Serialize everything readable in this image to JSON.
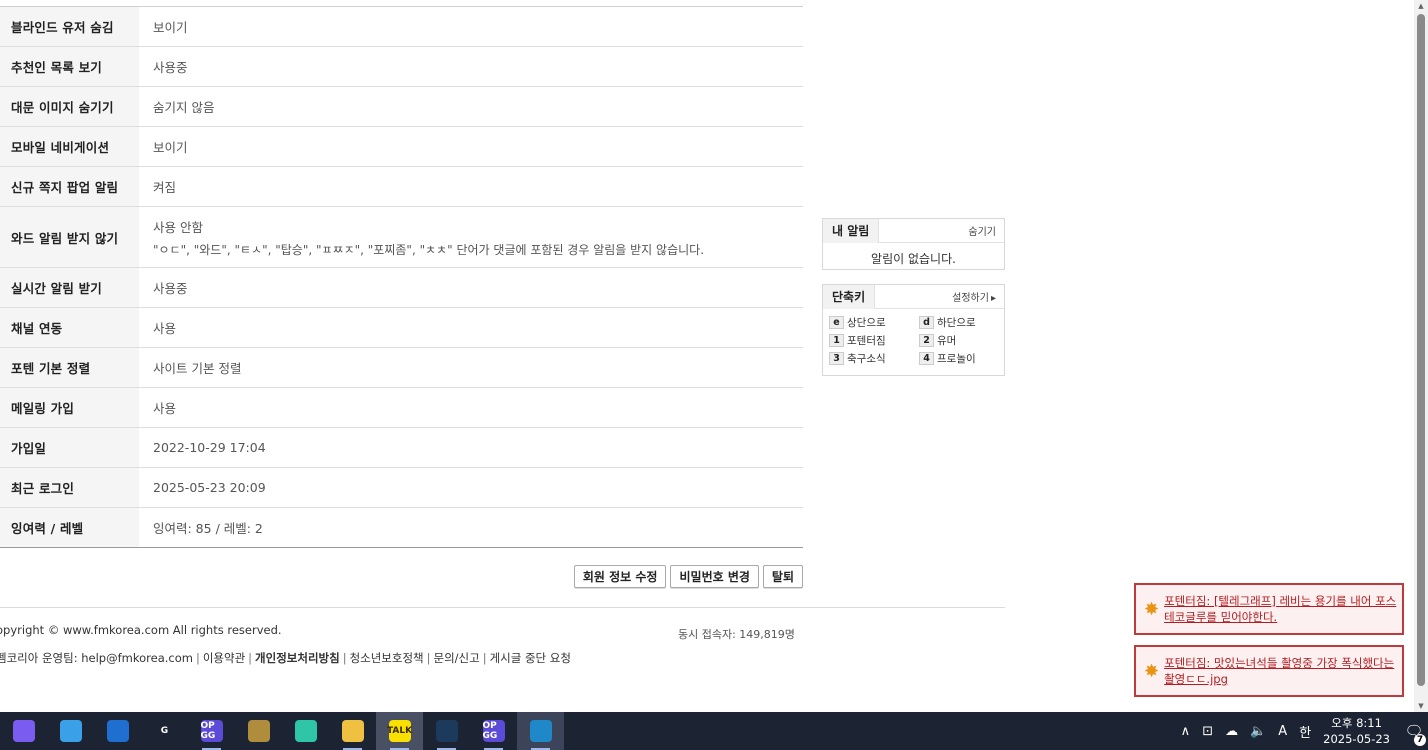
{
  "settings": [
    {
      "label": "블라인드 유저 숨김",
      "value": "보이기"
    },
    {
      "label": "추천인 목록 보기",
      "value": "사용중"
    },
    {
      "label": "대문 이미지 숨기기",
      "value": "숨기지 않음"
    },
    {
      "label": "모바일 네비게이션",
      "value": "보이기"
    },
    {
      "label": "신규 쪽지 팝업 알림",
      "value": "켜짐"
    },
    {
      "label": "와드 알림 받지 않기",
      "value": "사용 안함",
      "sub": "\"ㅇㄷ\", \"와드\", \"ㅌㅅ\", \"탑승\", \"ㅍㅉㅈ\", \"포찌좀\", \"ㅊㅊ\" 단어가 댓글에 포함된 경우 알림을 받지 않습니다."
    },
    {
      "label": "실시간 알림 받기",
      "value": "사용중"
    },
    {
      "label": "채널 연동",
      "value": "사용"
    },
    {
      "label": "포텐 기본 정렬",
      "value": "사이트 기본 정렬"
    },
    {
      "label": "메일링 가입",
      "value": "사용"
    },
    {
      "label": "가입일",
      "value": "2022-10-29 17:04"
    },
    {
      "label": "최근 로그인",
      "value": "2025-05-23 20:09"
    },
    {
      "label": "잉여력 / 레벨",
      "value": "잉여력: 85 / 레벨: 2"
    }
  ],
  "actions": {
    "edit_info": "회원 정보 수정",
    "change_password": "비밀번호 변경",
    "withdraw": "탈퇴"
  },
  "footer": {
    "copyright": "opyright © www.fmkorea.com All rights reserved.",
    "concurrent": "동시 접속자: 149,819명",
    "contact": "펨코리아 운영팀: help@fmkorea.com",
    "terms": "이용약관",
    "privacy": "개인정보처리방침",
    "youth": "청소년보호정책",
    "report": "문의/신고",
    "takedown": "게시글 중단 요청"
  },
  "alerts_widget": {
    "title": "내 알림",
    "hide": "숨기기",
    "empty": "알림이 없습니다."
  },
  "shortcuts_widget": {
    "title": "단축키",
    "settings": "설정하기",
    "items": [
      {
        "key": "e",
        "label": "상단으로"
      },
      {
        "key": "d",
        "label": "하단으로"
      },
      {
        "key": "1",
        "label": "포텐터짐"
      },
      {
        "key": "2",
        "label": "유머"
      },
      {
        "key": "3",
        "label": "축구소식"
      },
      {
        "key": "4",
        "label": "프로놀이"
      }
    ]
  },
  "toasts": [
    {
      "text": "포텐터짐: [텔레그래프] 레비는 용기를 내어 포스테코글루를 믿어야한다."
    },
    {
      "text": "포텐터짐: 맛있는녀석들 촬영중 가장 폭식했다는 촬영ㄷㄷ.jpg"
    }
  ],
  "taskbar": {
    "apps": [
      {
        "name": "copilot",
        "color": "#7b5cf0",
        "label": ""
      },
      {
        "name": "paint",
        "color": "#3aa0e8",
        "label": ""
      },
      {
        "name": "store",
        "color": "#1f6fd1",
        "label": ""
      },
      {
        "name": "g-app",
        "color": "#1c2433",
        "label": "G"
      },
      {
        "name": "opgg",
        "color": "#5b4bd6",
        "label": "OP GG"
      },
      {
        "name": "league",
        "color": "#b08d3c",
        "label": ""
      },
      {
        "name": "bird-app",
        "color": "#2fc6a8",
        "label": ""
      },
      {
        "name": "explorer",
        "color": "#f0c040",
        "label": ""
      },
      {
        "name": "kakaotalk",
        "color": "#f9e000",
        "label": "TALK"
      },
      {
        "name": "steam",
        "color": "#1b3a5c",
        "label": ""
      },
      {
        "name": "opgg-2",
        "color": "#5b4bd6",
        "label": "OP GG"
      },
      {
        "name": "edge",
        "color": "#1e88c9",
        "label": ""
      }
    ],
    "time_period": "오후 8:11",
    "date": "2025-05-23",
    "ime_lang": "A",
    "ime_mode": "한",
    "notif_count": "7"
  }
}
